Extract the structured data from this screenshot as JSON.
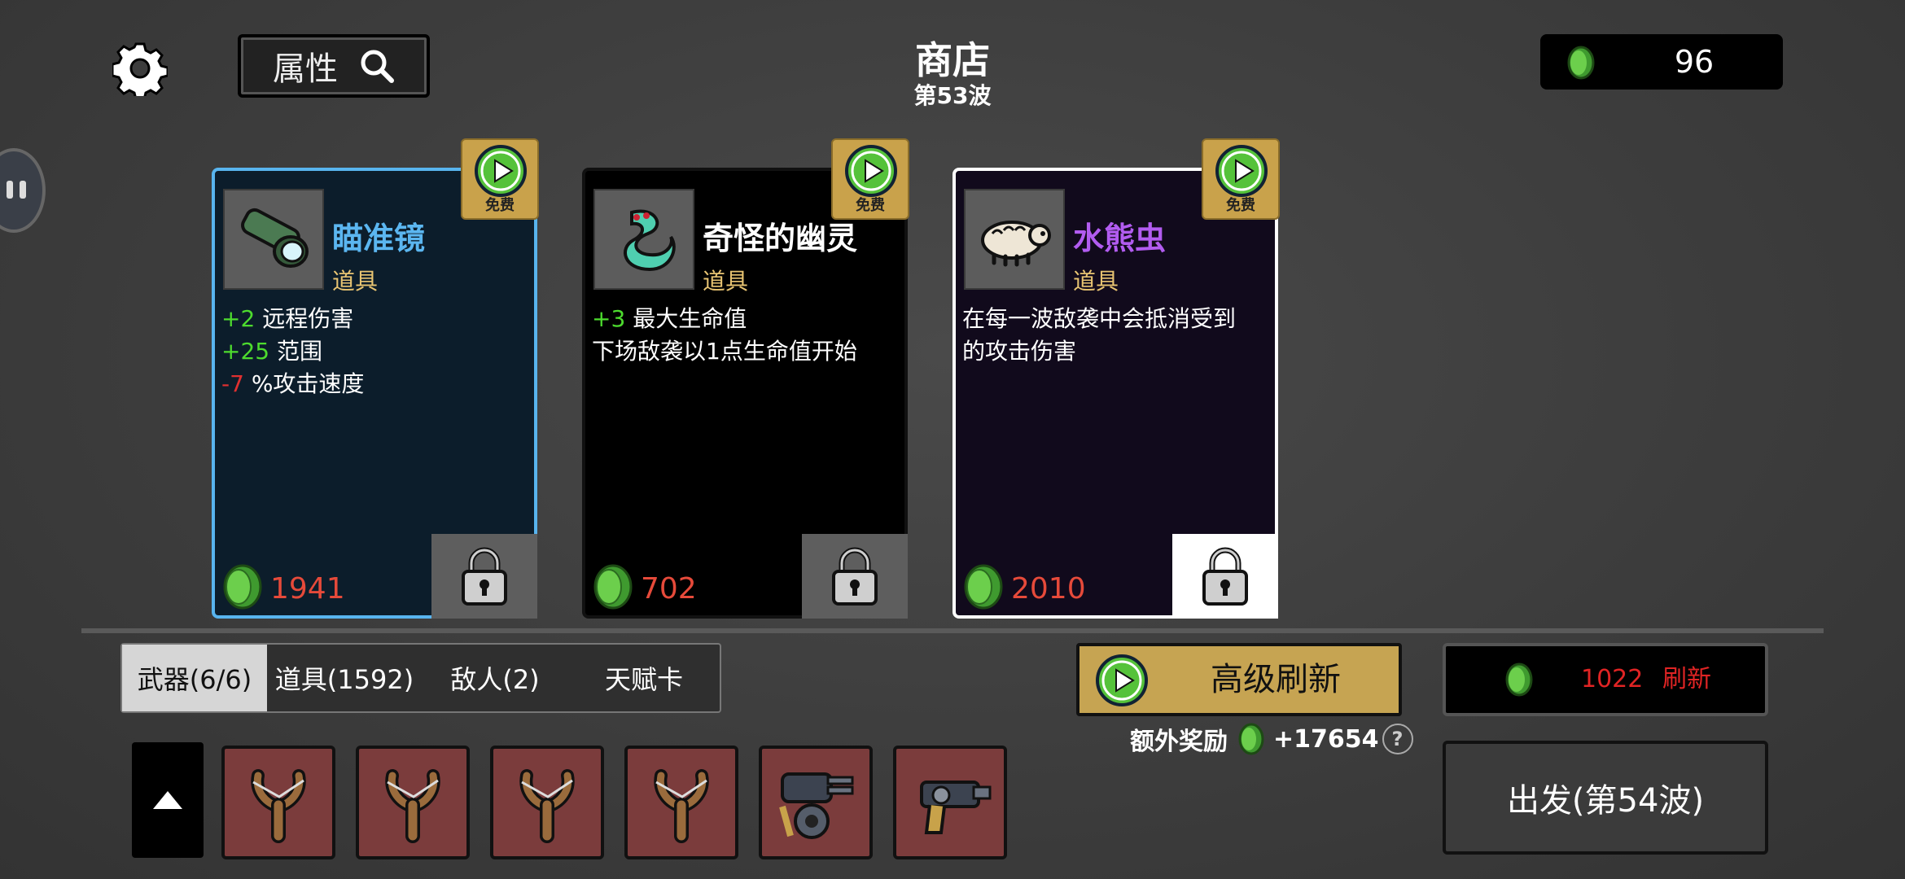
{
  "header": {
    "search_label": "属性",
    "title": "商店",
    "wave": "第53波",
    "gold": "96"
  },
  "cards": [
    {
      "name": "瞄准镜",
      "name_color": "#5bb6f0",
      "type": "道具",
      "free_label": "免费",
      "stats": [
        {
          "value": "+2",
          "text": "远程伤害"
        },
        {
          "value": "+25",
          "text": "范围"
        },
        {
          "value": "-7",
          "text": "%攻击速度"
        }
      ],
      "price": "1941"
    },
    {
      "name": "奇怪的幽灵",
      "name_color": "#ffffff",
      "type": "道具",
      "free_label": "免费",
      "stats": [
        {
          "value": "+3",
          "text": "最大生命值"
        }
      ],
      "extra_line": "下场敌袭以1点生命值开始",
      "price": "702"
    },
    {
      "name": "水熊虫",
      "name_color": "#b25cf0",
      "type": "道具",
      "free_label": "免费",
      "desc_line1": "在每一波敌袭中会抵消受到",
      "desc_line2": "的攻击伤害",
      "price": "2010"
    }
  ],
  "tabs": [
    "武器(6/6)",
    "道具(1592)",
    "敌人(2)",
    "天赋卡"
  ],
  "weapons": [
    "slingshot",
    "slingshot",
    "slingshot",
    "slingshot",
    "minigun",
    "blaster"
  ],
  "actions": {
    "advanced_refresh": "高级刷新",
    "bonus_label": "额外奖励",
    "bonus_value": "+17654",
    "bonus_help": "?",
    "refresh_cost": "1022",
    "refresh_label": "刷新",
    "depart": "出发(第54波)"
  },
  "colors": {
    "positive": "#4ddb2e",
    "negative": "#e03030",
    "price": "#e64a3a",
    "gold_button": "#c6a452"
  }
}
